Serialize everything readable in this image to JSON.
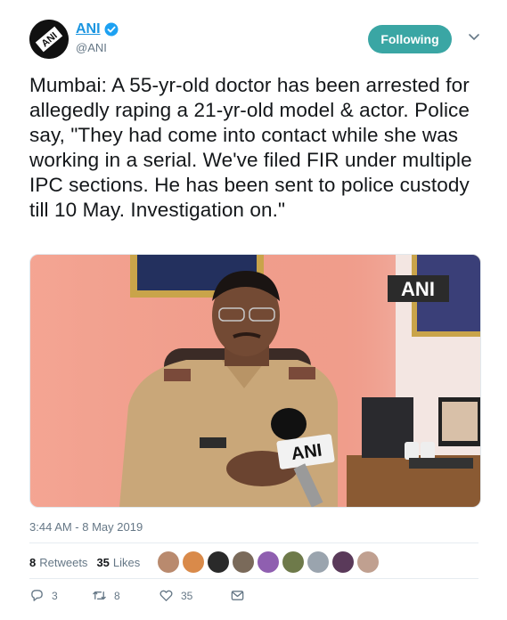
{
  "tweet": {
    "display_name": "ANI",
    "handle": "@ANI",
    "follow_label": "Following",
    "text": "Mumbai: A 55-yr-old doctor has been arrested for allegedly raping a 21-yr-old model & actor. Police say, \"They had come into contact while she was working in a serial. We've filed FIR under multiple IPC sections. He has been sent to police custody till 10 May. Investigation on.\"",
    "media_watermark": "ANI",
    "mic_label": "ANI",
    "timestamp": "3:44 AM - 8 May 2019"
  },
  "stats": {
    "retweets_count": "8",
    "retweets_label": "Retweets",
    "likes_count": "35",
    "likes_label": "Likes"
  },
  "actions": {
    "reply_count": "3",
    "retweet_count": "8",
    "like_count": "35"
  },
  "icons": [
    "verified-icon",
    "chevron-down-icon",
    "reply-icon",
    "retweet-icon",
    "like-icon",
    "message-icon"
  ],
  "colors": {
    "accent": "#1b95e0",
    "follow_button": "#3aa6a4",
    "muted": "#657786"
  }
}
